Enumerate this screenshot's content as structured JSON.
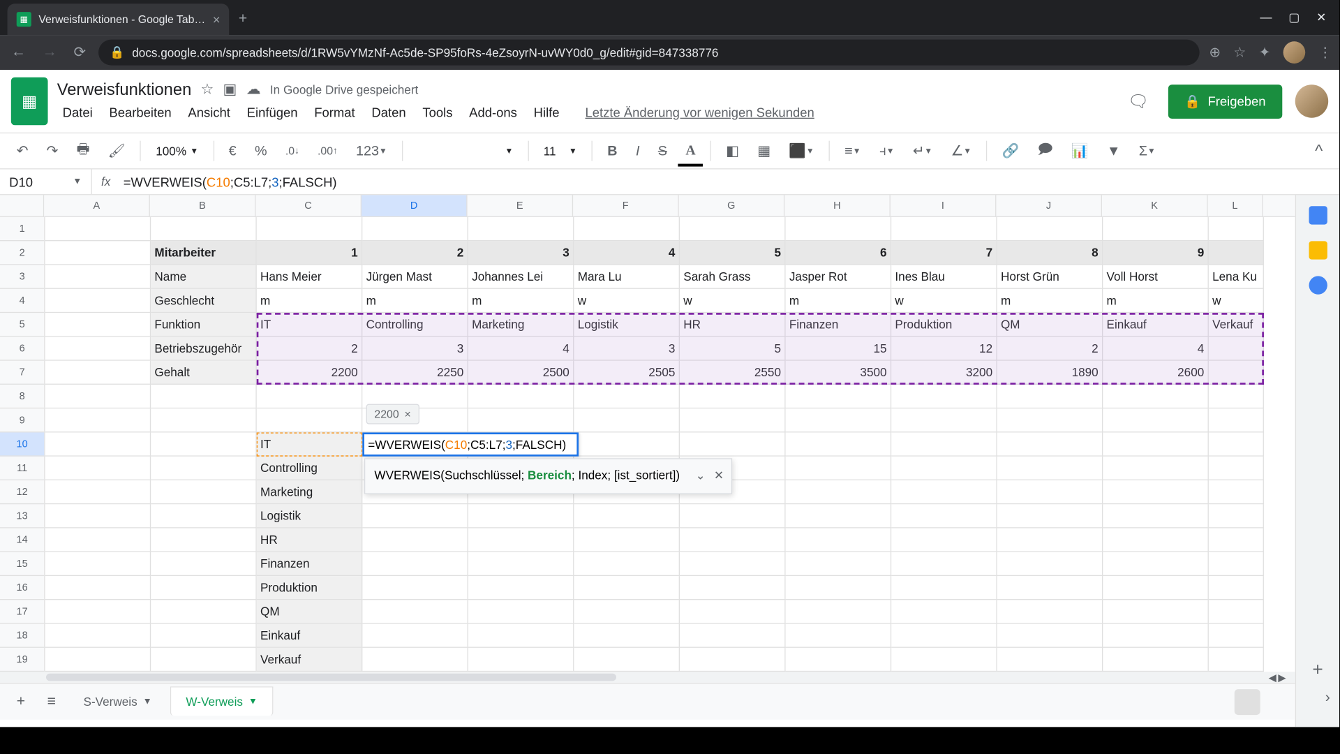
{
  "browser": {
    "tab_title": "Verweisfunktionen - Google Tab…",
    "url": "docs.google.com/spreadsheets/d/1RW5vYMzNf-Ac5de-SP95foRs-4eZsoyrN-uvWY0d0_g/edit#gid=847338776"
  },
  "doc": {
    "name": "Verweisfunktionen",
    "saved": "In Google Drive gespeichert",
    "last_edit": "Letzte Änderung vor wenigen Sekunden",
    "share": "Freigeben"
  },
  "menu": {
    "datei": "Datei",
    "bearbeiten": "Bearbeiten",
    "ansicht": "Ansicht",
    "einfuegen": "Einfügen",
    "format": "Format",
    "daten": "Daten",
    "tools": "Tools",
    "addons": "Add-ons",
    "hilfe": "Hilfe"
  },
  "toolbar": {
    "zoom": "100%",
    "font_size": "11",
    "symbols": {
      "euro": "€",
      "percent": "%",
      "dec_dec": ".0",
      "dec_inc": ".00",
      "num_fmt": "123"
    }
  },
  "formula_bar": {
    "cell_ref": "D10",
    "formula_prefix": "=WVERWEIS(",
    "formula_c10": "C10",
    "formula_range": ";C5:L7;",
    "formula_idx": "3",
    "formula_suffix": ";FALSCH)"
  },
  "columns": [
    "A",
    "B",
    "C",
    "D",
    "E",
    "F",
    "G",
    "H",
    "I",
    "J",
    "K",
    "L"
  ],
  "row_numbers": [
    "1",
    "2",
    "3",
    "4",
    "5",
    "6",
    "7",
    "8",
    "9",
    "10",
    "11",
    "12",
    "13",
    "14",
    "15",
    "16",
    "17",
    "18",
    "19"
  ],
  "data": {
    "r2": {
      "B": "Mitarbeiter",
      "C": "1",
      "D": "2",
      "E": "3",
      "F": "4",
      "G": "5",
      "H": "6",
      "I": "7",
      "J": "8",
      "K": "9"
    },
    "r3": {
      "B": "Name",
      "C": "Hans Meier",
      "D": "Jürgen Mast",
      "E": "Johannes Lei",
      "F": "Mara Lu",
      "G": "Sarah Grass",
      "H": "Jasper Rot",
      "I": "Ines Blau",
      "J": "Horst Grün",
      "K": "Voll Horst",
      "L": "Lena Ku"
    },
    "r4": {
      "B": "Geschlecht",
      "C": "m",
      "D": "m",
      "E": "m",
      "F": "w",
      "G": "w",
      "H": "m",
      "I": "w",
      "J": "m",
      "K": "m",
      "L": "w"
    },
    "r5": {
      "B": "Funktion",
      "C": "IT",
      "D": "Controlling",
      "E": "Marketing",
      "F": "Logistik",
      "G": "HR",
      "H": "Finanzen",
      "I": "Produktion",
      "J": "QM",
      "K": "Einkauf",
      "L": "Verkauf"
    },
    "r6": {
      "B": "Betriebszugehör",
      "C": "2",
      "D": "3",
      "E": "4",
      "F": "3",
      "G": "5",
      "H": "15",
      "I": "12",
      "J": "2",
      "K": "4"
    },
    "r7": {
      "B": "Gehalt",
      "C": "2200",
      "D": "2250",
      "E": "2500",
      "F": "2505",
      "G": "2550",
      "H": "3500",
      "I": "3200",
      "J": "1890",
      "K": "2600"
    },
    "r10": {
      "C": "IT"
    },
    "r11": {
      "C": "Controlling"
    },
    "r12": {
      "C": "Marketing"
    },
    "r13": {
      "C": "Logistik"
    },
    "r14": {
      "C": "HR"
    },
    "r15": {
      "C": "Finanzen"
    },
    "r16": {
      "C": "Produktion"
    },
    "r17": {
      "C": "QM"
    },
    "r18": {
      "C": "Einkauf"
    },
    "r19": {
      "C": "Verkauf"
    }
  },
  "inline_edit": {
    "prefix": "=WVERWEIS(",
    "c10": "C10",
    "range": ";C5:L7;",
    "idx": "3",
    "suffix": ";FALSCH)"
  },
  "result_chip": {
    "value": "2200",
    "close": "×"
  },
  "help_tip": {
    "text1": "WVERWEIS(Suchschlüssel; ",
    "hl": "Bereich",
    "text2": "; Index; [ist_sortiert])"
  },
  "tabs": {
    "s": "S-Verweis",
    "w": "W-Verweis"
  }
}
